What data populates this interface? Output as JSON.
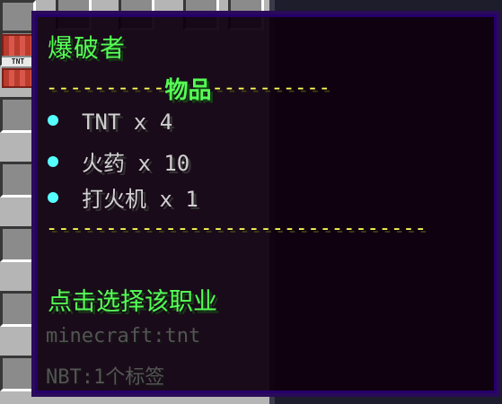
{
  "tooltip": {
    "title": "爆破者",
    "divider_left": "----------",
    "section_title": "物品",
    "divider_right": "----------",
    "items": [
      {
        "label": "TNT x 4",
        "bullet_color": "#55ffff"
      },
      {
        "label": "火药 x 10",
        "bullet_color": "#55ffff"
      },
      {
        "label": "打火机 x 1",
        "bullet_color": "#55ffff"
      }
    ],
    "divider_bottom": "--------------------------------",
    "action": "点击选择该职业",
    "item_id": "minecraft:tnt",
    "nbt": "NBT:1个标签"
  },
  "icon": {
    "item": "tnt-icon",
    "label": "TNT"
  },
  "colors": {
    "title_green": "#55ff55",
    "divider_yellow": "#ffff55",
    "bullet_cyan": "#55ffff",
    "item_gray": "#d0d0d0",
    "meta_gray": "#545454"
  }
}
